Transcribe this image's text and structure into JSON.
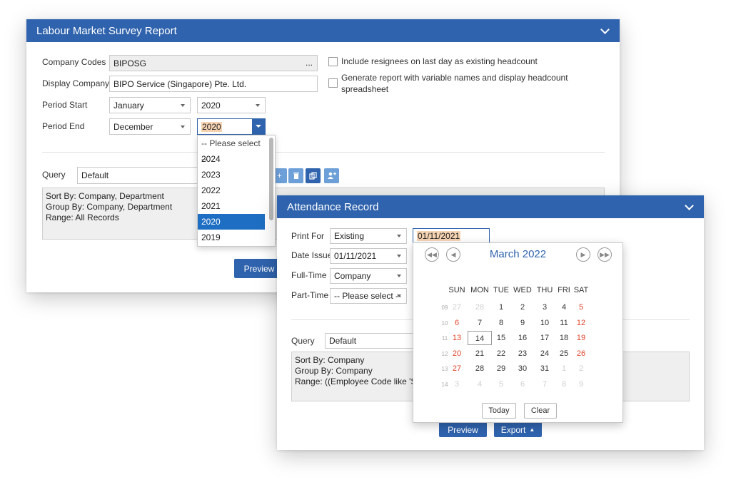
{
  "lm": {
    "title": "Labour Market Survey Report",
    "company_codes_label": "Company Codes",
    "company_codes_value": "BIPOSG",
    "company_codes_more": "...",
    "display_company_label": "Display Company",
    "display_company_value": "BIPO Service (Singapore) Pte. Ltd.",
    "period_start_label": "Period Start",
    "period_start_month": "January",
    "period_start_year": "2020",
    "period_end_label": "Period End",
    "period_end_month": "December",
    "period_end_year": "2020",
    "include_resignees_label": "Include resignees on last day as existing headcount",
    "generate_report_label_1": "Generate report with variable names and display headcount",
    "generate_report_label_2": "spreadsheet",
    "query_label": "Query",
    "query_value": "Default",
    "criteria": [
      "Sort By: Company, Department",
      "Group By: Company, Department",
      "Range: All Records"
    ],
    "preview_label": "Preview",
    "year_options": [
      "-- Please select --",
      "2024",
      "2023",
      "2022",
      "2021",
      "2020",
      "2019"
    ],
    "year_selected": "2020"
  },
  "ar": {
    "title": "Attendance Record",
    "print_for_label": "Print For",
    "print_for_value": "Existing",
    "print_date_value": "01/11/2021",
    "date_issue_label": "Date Issue",
    "date_issue_value": "01/11/2021",
    "full_time_label": "Full-Time",
    "full_time_value": "Company",
    "part_time_label": "Part-Time",
    "part_time_value": "-- Please select --",
    "query_label": "Query",
    "query_value": "Default",
    "criteria": [
      "Sort By: Company",
      "Group By: Company",
      "Range: ((Employee Code like 'SG%'"
    ],
    "preview_label": "Preview",
    "export_label": "Export"
  },
  "calendar": {
    "month_label": "March 2022",
    "day_headers": [
      "SUN",
      "MON",
      "TUE",
      "WED",
      "THU",
      "FRI",
      "SAT"
    ],
    "weeks": [
      {
        "num": "09",
        "days": [
          {
            "d": "27",
            "t": "other"
          },
          {
            "d": "28",
            "t": "other"
          },
          {
            "d": "1",
            "t": ""
          },
          {
            "d": "2",
            "t": ""
          },
          {
            "d": "3",
            "t": ""
          },
          {
            "d": "4",
            "t": ""
          },
          {
            "d": "5",
            "t": "wkend"
          }
        ]
      },
      {
        "num": "10",
        "days": [
          {
            "d": "6",
            "t": "wkend"
          },
          {
            "d": "7",
            "t": ""
          },
          {
            "d": "8",
            "t": ""
          },
          {
            "d": "9",
            "t": ""
          },
          {
            "d": "10",
            "t": ""
          },
          {
            "d": "11",
            "t": ""
          },
          {
            "d": "12",
            "t": "wkend"
          }
        ]
      },
      {
        "num": "11",
        "days": [
          {
            "d": "13",
            "t": "wkend"
          },
          {
            "d": "14",
            "t": "selected"
          },
          {
            "d": "15",
            "t": ""
          },
          {
            "d": "16",
            "t": ""
          },
          {
            "d": "17",
            "t": ""
          },
          {
            "d": "18",
            "t": ""
          },
          {
            "d": "19",
            "t": "wkend"
          }
        ]
      },
      {
        "num": "12",
        "days": [
          {
            "d": "20",
            "t": "wkend"
          },
          {
            "d": "21",
            "t": ""
          },
          {
            "d": "22",
            "t": ""
          },
          {
            "d": "23",
            "t": ""
          },
          {
            "d": "24",
            "t": ""
          },
          {
            "d": "25",
            "t": ""
          },
          {
            "d": "26",
            "t": "wkend"
          }
        ]
      },
      {
        "num": "13",
        "days": [
          {
            "d": "27",
            "t": "wkend"
          },
          {
            "d": "28",
            "t": ""
          },
          {
            "d": "29",
            "t": ""
          },
          {
            "d": "30",
            "t": ""
          },
          {
            "d": "31",
            "t": ""
          },
          {
            "d": "1",
            "t": "other"
          },
          {
            "d": "2",
            "t": "other"
          }
        ]
      },
      {
        "num": "14",
        "days": [
          {
            "d": "3",
            "t": "other"
          },
          {
            "d": "4",
            "t": "other"
          },
          {
            "d": "5",
            "t": "other"
          },
          {
            "d": "6",
            "t": "other"
          },
          {
            "d": "7",
            "t": "other"
          },
          {
            "d": "8",
            "t": "other"
          },
          {
            "d": "9",
            "t": "other"
          }
        ]
      }
    ],
    "today_label": "Today",
    "clear_label": "Clear"
  },
  "colors": {
    "titlebar": "#2f63ad",
    "button": "#2f63ad",
    "icon_button": "#6d9fd8",
    "weekend": "#e0452b",
    "selected_option": "#1e6fc3",
    "highlight": "#f6d3b3"
  },
  "icons": [
    "chevron-down-icon",
    "add-icon",
    "delete-icon",
    "copy-icon",
    "add-user-icon",
    "chevron-up-icon",
    "first-page-icon",
    "prev-icon",
    "next-icon",
    "last-page-icon"
  ]
}
